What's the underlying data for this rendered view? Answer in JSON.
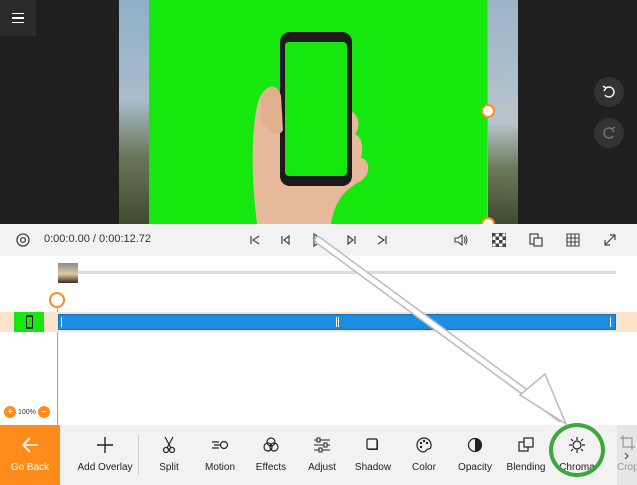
{
  "player": {
    "current_time": "0:00:0.00",
    "total_time": "0:00:12.72",
    "time_separator": " / "
  },
  "timeline": {
    "zoom_level": "100%"
  },
  "toolbar": {
    "go_back": "Go Back",
    "tools": [
      {
        "label": "Add Overlay"
      },
      {
        "label": "Split"
      },
      {
        "label": "Motion"
      },
      {
        "label": "Effects"
      },
      {
        "label": "Adjust"
      },
      {
        "label": "Shadow"
      },
      {
        "label": "Color"
      },
      {
        "label": "Opacity"
      },
      {
        "label": "Blending"
      },
      {
        "label": "Chroma"
      },
      {
        "label": "Crop"
      }
    ]
  },
  "colors": {
    "accent": "#ff8c1a",
    "chroma_green": "#16e80f",
    "clip_blue": "#1b8ee0",
    "highlight_ring": "#3aa83a"
  }
}
